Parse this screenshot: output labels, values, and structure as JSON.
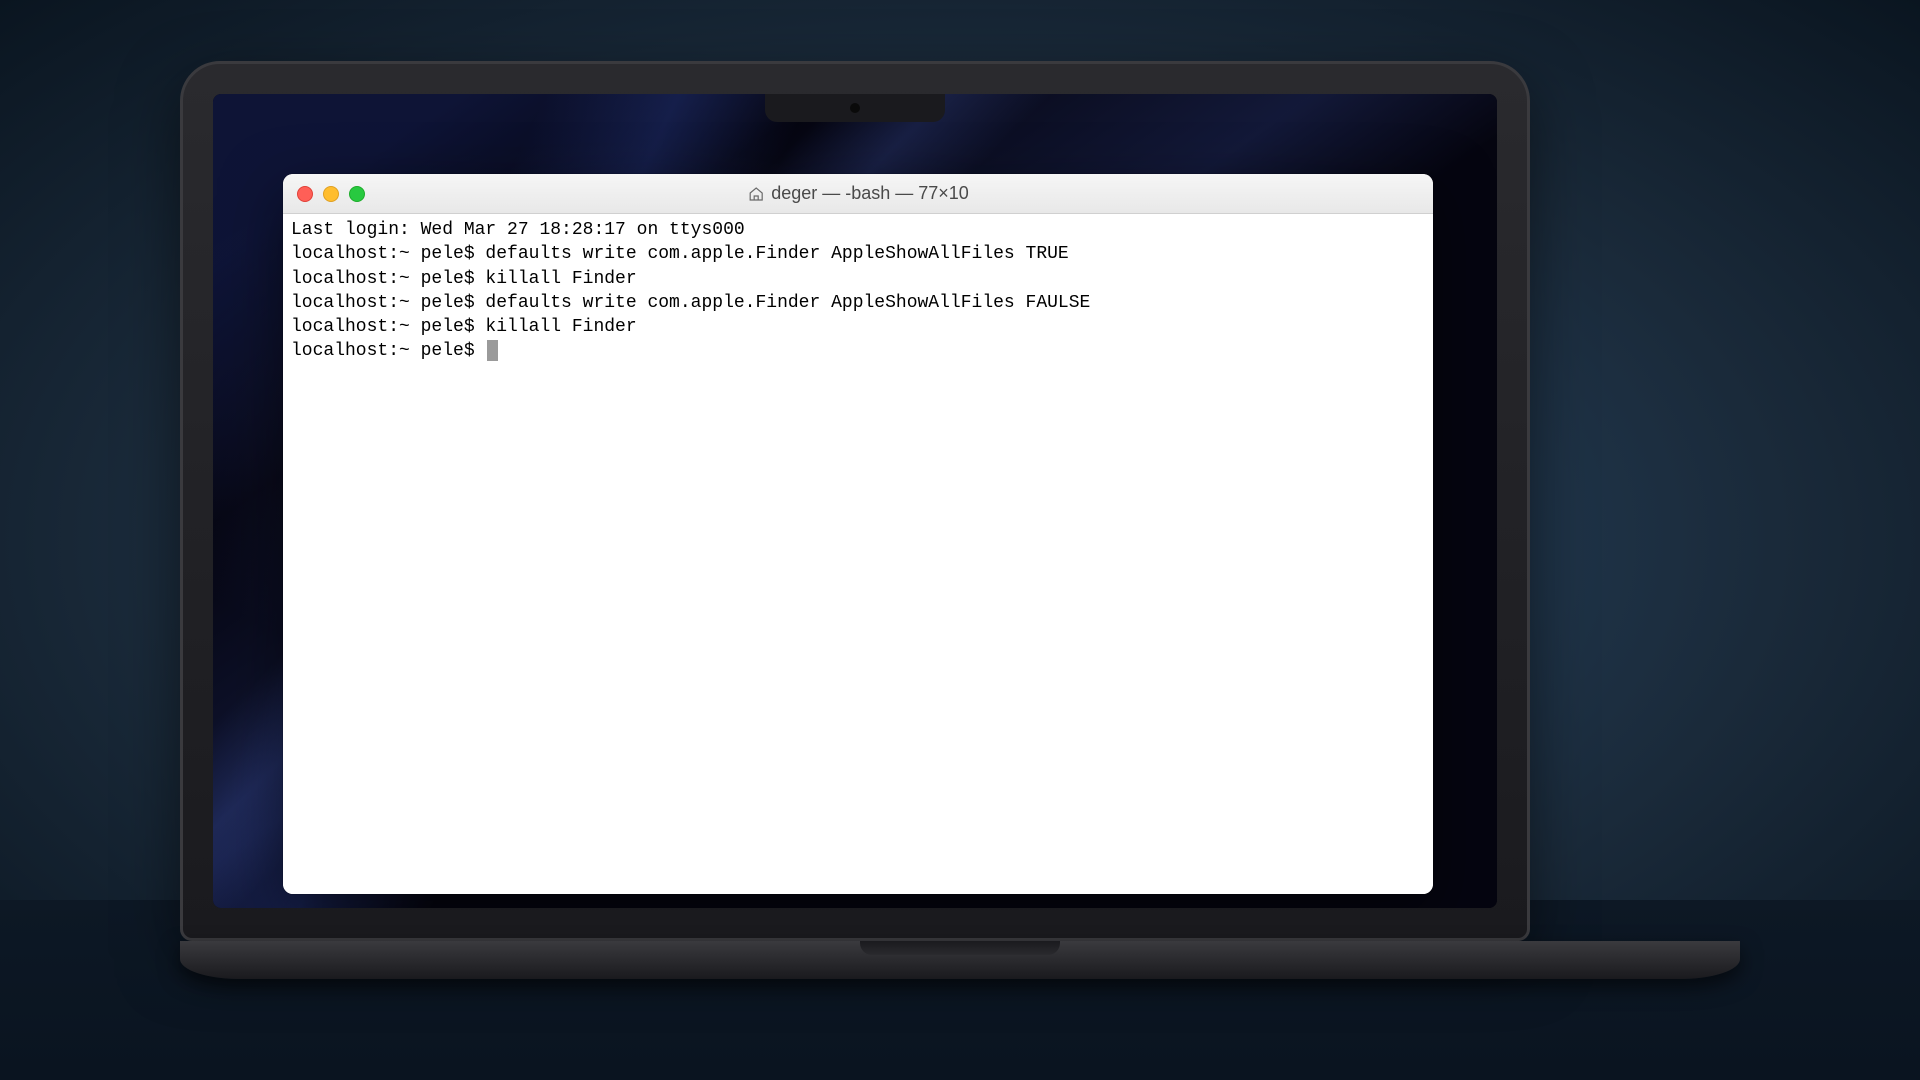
{
  "window": {
    "title": "deger — -bash — 77×10"
  },
  "terminal": {
    "lines": [
      "Last login: Wed Mar 27 18:28:17 on ttys000",
      "localhost:~ pele$ defaults write com.apple.Finder AppleShowAllFiles TRUE",
      "localhost:~ pele$ killall Finder",
      "localhost:~ pele$ defaults write com.apple.Finder AppleShowAllFiles FAULSE",
      "localhost:~ pele$ killall Finder"
    ],
    "prompt": "localhost:~ pele$ "
  }
}
